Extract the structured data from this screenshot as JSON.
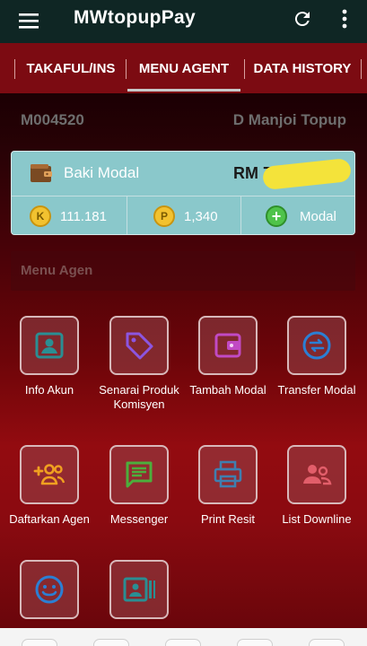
{
  "appbar": {
    "title": "MWtopupPay"
  },
  "tabs": [
    {
      "label": "TAKAFUL/INS",
      "active": false
    },
    {
      "label": "MENU AGENT",
      "active": true
    },
    {
      "label": "DATA HISTORY",
      "active": false
    }
  ],
  "agent": {
    "id": "M004520",
    "name": "D Manjoi Topup"
  },
  "balance": {
    "label": "Baki Modal",
    "amount": "RM 7",
    "points_k": "111.181",
    "points_p": "1,340",
    "topup_label": "Modal"
  },
  "section": {
    "title": "Menu Agen"
  },
  "menu": [
    {
      "label": "Info Akun",
      "icon": "contact-card-icon",
      "color": "#2a8e93"
    },
    {
      "label": "Senarai Produk Komisyen",
      "icon": "price-tag-icon",
      "color": "#8c55e0"
    },
    {
      "label": "Tambah Modal",
      "icon": "wallet-icon",
      "color": "#c14ac4"
    },
    {
      "label": "Transfer Modal",
      "icon": "swap-arrows-icon",
      "color": "#2b7fd4"
    },
    {
      "label": "Daftarkan Agen",
      "icon": "group-add-icon",
      "color": "#f0a020"
    },
    {
      "label": "Messenger",
      "icon": "message-icon",
      "color": "#4caf3c"
    },
    {
      "label": "Print Resit",
      "icon": "printer-icon",
      "color": "#3f7fb0"
    },
    {
      "label": "List Downline",
      "icon": "people-icon",
      "color": "#e25e6a"
    },
    {
      "label": "",
      "icon": "smiley-icon",
      "color": "#2b7fd4"
    },
    {
      "label": "",
      "icon": "id-card-icon",
      "color": "#2a8e93"
    }
  ],
  "colors": {
    "appbar": "#0f2624",
    "tabbar": "#7c0b12",
    "card": "#8ac8cb"
  }
}
